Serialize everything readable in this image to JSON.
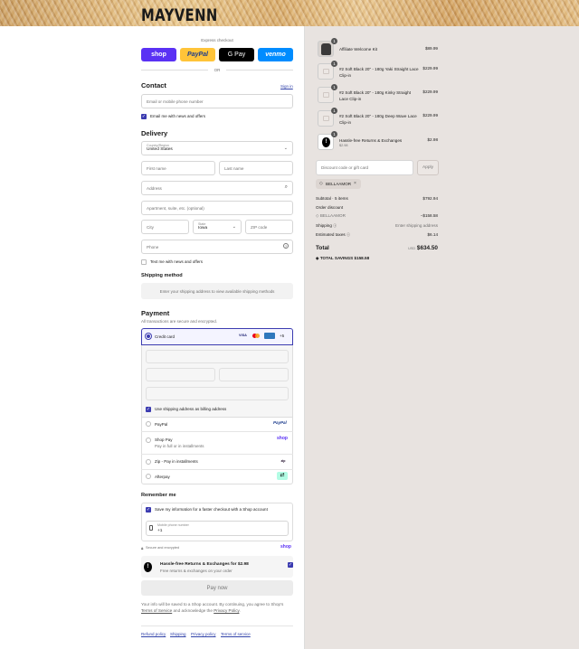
{
  "brand": "MAYVENN",
  "express": {
    "label": "Express checkout",
    "or": "OR",
    "shop": "shop",
    "paypal": "PayPal",
    "gpay": "G Pay",
    "venmo": "venmo"
  },
  "contact": {
    "title": "Contact",
    "signin": "Sign in",
    "email_placeholder": "Email or mobile phone number",
    "news": "Email me with news and offers"
  },
  "delivery": {
    "title": "Delivery",
    "country_label": "Country/Region",
    "country": "United States",
    "first": "First name",
    "last": "Last name",
    "address": "Address",
    "apt": "Apartment, suite, etc. (optional)",
    "city": "City",
    "state_label": "State",
    "state": "Iowa",
    "zip": "ZIP code",
    "phone": "Phone",
    "text_news": "Text me with news and offers"
  },
  "shipping": {
    "title": "Shipping method",
    "note": "Enter your shipping address to view available shipping methods"
  },
  "payment": {
    "title": "Payment",
    "sub": "All transactions are secure and encrypted.",
    "cc": "Credit card",
    "cc_more": "+5",
    "visa": "VISA",
    "billing": "Use shipping address as billing address",
    "paypal": "PayPal",
    "paypal_logo": "PayPal",
    "shoppay": "Shop Pay",
    "shoppay_sub": "Pay in full or in installments",
    "shoppay_logo": "shop",
    "zip": "Zip - Pay in installments",
    "zip_logo": "zip",
    "afterpay": "Afterpay"
  },
  "remember": {
    "title": "Remember me",
    "save": "Save my information for a faster checkout with a Shop account",
    "mobile_label": "Mobile phone number",
    "mobile": "+1",
    "secure": "Secure and encrypted",
    "shop": "shop"
  },
  "returns": {
    "title": "Hassle-free Returns & Exchanges for $2.98",
    "sub": "Free returns & exchanges on your order"
  },
  "pay": "Pay now",
  "legal": {
    "l1": "Your info will be saved to a Shop account. By continuing, you agree to Shop's",
    "tos": "Terms of Service",
    "and": "and acknowledge the",
    "privacy": "Privacy Policy",
    "end": "."
  },
  "footer": [
    "Refund policy",
    "Shipping",
    "Privacy policy",
    "Terms of service"
  ],
  "items": [
    {
      "qty": "1",
      "name": "Affiliate Welcome Kit",
      "sub": "",
      "price": "$89.99"
    },
    {
      "qty": "1",
      "name": "#2 Soft Black 20\" - 180g Yaki Straight Lace Clip-in",
      "sub": "",
      "price": "$229.99"
    },
    {
      "qty": "1",
      "name": "#2 Soft Black 20\" - 180g Kinky Straight Lace Clip-in",
      "sub": "",
      "price": "$229.99"
    },
    {
      "qty": "1",
      "name": "#2 Soft Black 20\" - 180g Deep Wave Lace Clip-in",
      "sub": "",
      "price": "$229.99"
    },
    {
      "qty": "1",
      "name": "Hassle-free Returns & Exchanges",
      "sub": "$2.98",
      "price": "$2.98"
    }
  ],
  "discount": {
    "placeholder": "Discount code or gift card",
    "apply": "Apply",
    "code": "BELLAAMOR"
  },
  "summary": {
    "subtotal_label": "Subtotal · 5 items",
    "subtotal": "$792.94",
    "order_discount": "Order discount",
    "code": "BELLAAMOR",
    "discount": "−$158.58",
    "shipping_label": "Shipping",
    "shipping": "Enter shipping address",
    "taxes_label": "Estimated taxes",
    "taxes": "$6.14",
    "total_label": "Total",
    "currency": "USD",
    "total": "$634.50",
    "savings_label": "TOTAL SAVINGS",
    "savings": "$158.58"
  },
  "colors": {
    "accent": "#3b3bb0",
    "shop": "#5a31f4",
    "paypal": "#ffc439",
    "venmo": "#008cff",
    "panel": "#e8e3e0"
  }
}
